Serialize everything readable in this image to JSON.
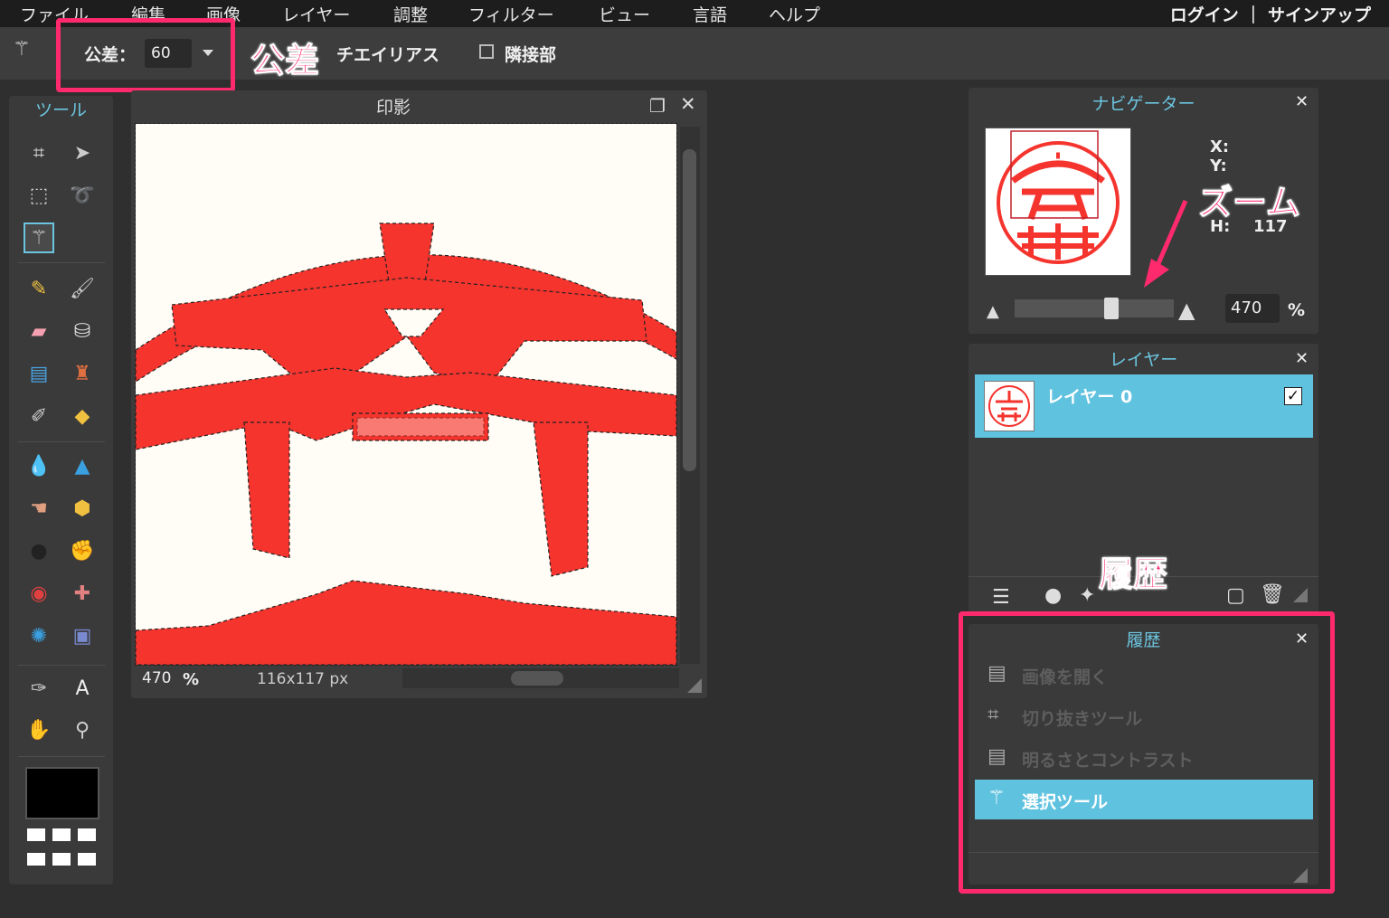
{
  "menu": [
    "ファイル",
    "編集",
    "画像",
    "レイヤー",
    "調整",
    "フィルター",
    "ビュー",
    "言語",
    "ヘルプ"
  ],
  "auth": "ログイン ｜ サインアップ",
  "options": {
    "tolerance_label": "公差：",
    "tolerance_value": "60",
    "antialias_label": "チエイリアス",
    "contiguous_label": "隣接部"
  },
  "annotations": {
    "tolerance": "公差",
    "zoom": "ズーム",
    "history": "履歴"
  },
  "tools_title": "ツール",
  "tools": [
    "crop-icon",
    "move-icon",
    "marquee-icon",
    "lasso-icon",
    "magic-wand-icon",
    "pencil-icon",
    "brush-icon",
    "eraser-icon",
    "bucket-icon",
    "gradient-icon",
    "stamp-icon",
    "color-replace-icon",
    "shape-icon",
    "blur-icon",
    "sharpen-icon",
    "smudge-icon",
    "sponge-icon",
    "dodge-icon",
    "burn-icon",
    "red-eye-icon",
    "spot-heal-icon",
    "bloat-icon",
    "pinch-icon",
    "color-picker-icon",
    "type-icon",
    "hand-icon",
    "zoom-icon"
  ],
  "document": {
    "title": "印影",
    "zoom": "470",
    "zoom_unit": "%",
    "size": "116x117 px"
  },
  "navigator": {
    "title": "ナビゲーター",
    "x_label": "X:",
    "y_label": "Y:",
    "h_label": "H:",
    "h_value": "117",
    "zoom_value": "470",
    "zoom_unit": "%",
    "zoom_level": 0.61
  },
  "layers": {
    "title": "レイヤー",
    "items": [
      {
        "name": "レイヤー 0",
        "visible": true
      }
    ]
  },
  "history": {
    "title": "履歴",
    "items": [
      {
        "label": "画像を開く",
        "icon": "document-icon",
        "selected": false
      },
      {
        "label": "切り抜きツール",
        "icon": "crop-icon",
        "selected": false
      },
      {
        "label": "明るさとコントラスト",
        "icon": "document-icon",
        "selected": false
      },
      {
        "label": "選択ツール",
        "icon": "magic-wand-icon",
        "selected": true
      }
    ]
  },
  "colors": {
    "accent": "#6cc5e0",
    "selection": "#5fc2df",
    "highlight": "#ff2a6d",
    "stamp_red": "#f5342e"
  }
}
